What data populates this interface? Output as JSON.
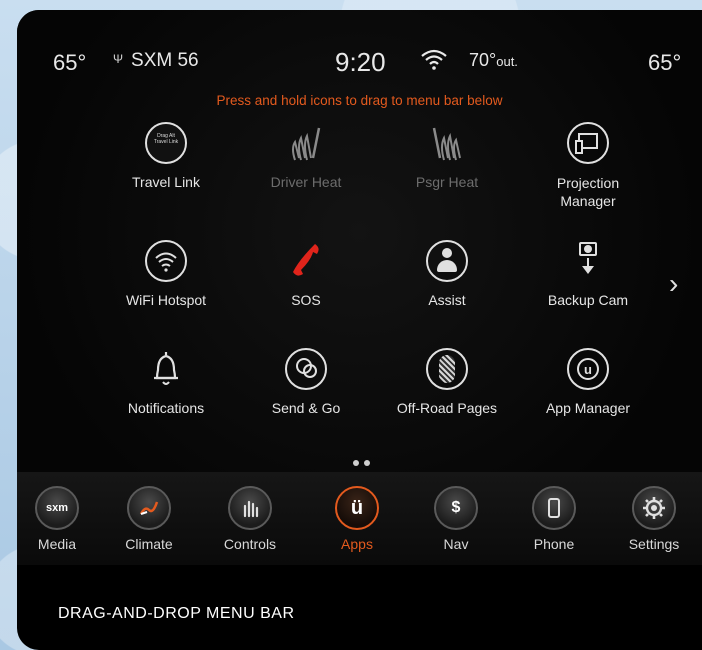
{
  "status": {
    "temp_left": "65°",
    "radio": "SXM 56",
    "time": "9:20",
    "outside_temp": "70°",
    "outside_label": "out.",
    "temp_right": "65°"
  },
  "instruction": "Press and hold icons to drag to menu bar below",
  "apps": [
    {
      "label": "Travel Link",
      "icon": "travel-link-icon",
      "dim": false
    },
    {
      "label": "Driver Heat",
      "icon": "driver-heat-icon",
      "dim": true
    },
    {
      "label": "Psgr Heat",
      "icon": "passenger-heat-icon",
      "dim": true
    },
    {
      "label": "Projection Manager",
      "icon": "projection-manager-icon",
      "dim": false
    },
    {
      "label": "WiFi Hotspot",
      "icon": "wifi-hotspot-icon",
      "dim": false
    },
    {
      "label": "SOS",
      "icon": "sos-phone-icon",
      "dim": false
    },
    {
      "label": "Assist",
      "icon": "assist-icon",
      "dim": false
    },
    {
      "label": "Backup Cam",
      "icon": "backup-camera-icon",
      "dim": false
    },
    {
      "label": "Notifications",
      "icon": "bell-icon",
      "dim": false
    },
    {
      "label": "Send & Go",
      "icon": "send-and-go-icon",
      "dim": false
    },
    {
      "label": "Off-Road Pages",
      "icon": "off-road-pages-icon",
      "dim": false
    },
    {
      "label": "App Manager",
      "icon": "app-manager-icon",
      "dim": false
    }
  ],
  "travel_link_icon_text": "Drag Alt Travel Link",
  "menubar": [
    {
      "label": "Media",
      "icon": "sxm-icon",
      "glyph": "sxm",
      "active": false
    },
    {
      "label": "Climate",
      "icon": "climate-icon",
      "glyph": "",
      "active": false
    },
    {
      "label": "Controls",
      "icon": "controls-icon",
      "glyph": "",
      "active": false
    },
    {
      "label": "Apps",
      "icon": "apps-icon",
      "glyph": "ü",
      "active": true
    },
    {
      "label": "Nav",
      "icon": "nav-icon",
      "glyph": "$",
      "active": false
    },
    {
      "label": "Phone",
      "icon": "phone-icon",
      "glyph": "",
      "active": false
    },
    {
      "label": "Settings",
      "icon": "gear-icon",
      "glyph": "",
      "active": false
    }
  ],
  "caption": "DRAG-AND-DROP MENU BAR",
  "colors": {
    "accent": "#e35a1e",
    "sos": "#e0241b"
  }
}
